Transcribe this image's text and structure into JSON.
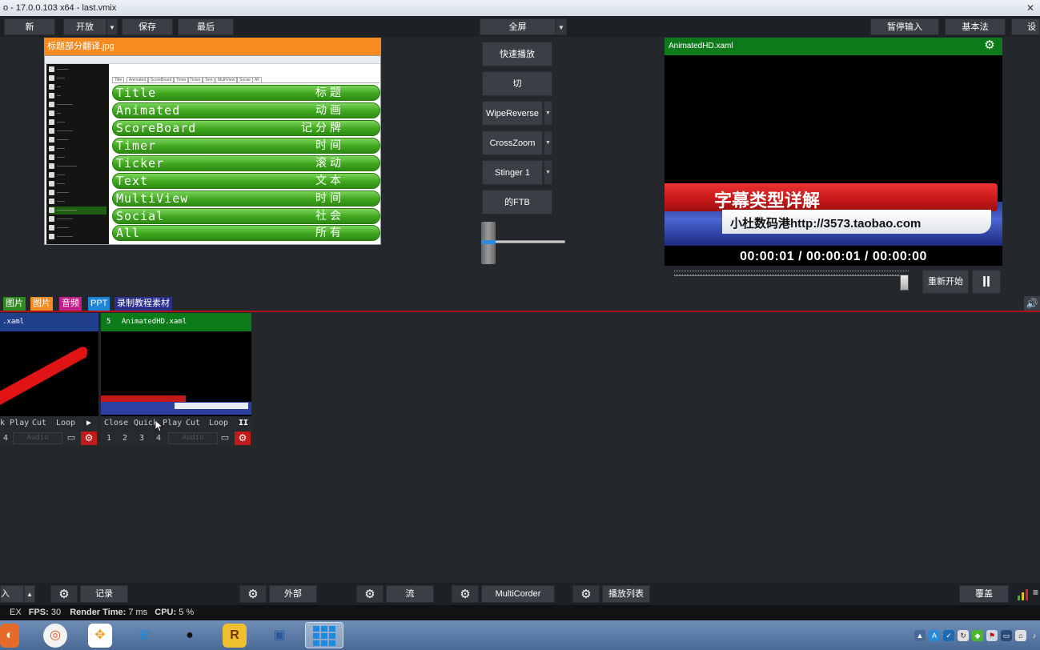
{
  "window": {
    "title": "o - 17.0.0.103 x64 - last.vmix"
  },
  "toolbar": {
    "new": "新",
    "open": "开放",
    "save": "保存",
    "last": "最后",
    "fullscreen": "全屏",
    "pause_input": "暂停输入",
    "basic": "基本法",
    "settings_cut": "设"
  },
  "preview": {
    "title": "标题部分翻译.jpg",
    "tabs": [
      "Title",
      "Animated",
      "ScoreBoard",
      "Timer",
      "Ticker",
      "Text",
      "MultiView",
      "Social",
      "All"
    ],
    "rows": [
      {
        "en": "Title",
        "zh": "标题"
      },
      {
        "en": "Animated",
        "zh": "动画"
      },
      {
        "en": "ScoreBoard",
        "zh": "记分牌"
      },
      {
        "en": "Timer",
        "zh": "时间"
      },
      {
        "en": "Ticker",
        "zh": "滚动"
      },
      {
        "en": "Text",
        "zh": "文本"
      },
      {
        "en": "MultiView",
        "zh": "时间"
      },
      {
        "en": "Social",
        "zh": "社会"
      },
      {
        "en": "All",
        "zh": "所有"
      }
    ]
  },
  "transitions": {
    "quick_play": "快速播放",
    "cut": "切",
    "t1": "WipeReverse",
    "t2": "CrossZoom",
    "t3": "Stinger 1",
    "ftb": "的FTB"
  },
  "output": {
    "title": "AnimatedHD.xaml",
    "caption_title": "字幕类型详解",
    "caption_sub": "小杜数码港http://3573.taobao.com",
    "timecode": "00:00:01  /  00:00:01  /  00:00:00",
    "restart": "重新开始",
    "pause": "II",
    "seek_fraction": 0.98
  },
  "categories": [
    {
      "label": "图片",
      "color": "#2f8a1f"
    },
    {
      "label": "图片",
      "color": "#f68a1e"
    },
    {
      "label": "音频",
      "color": "#c0208a"
    },
    {
      "label": "PPT",
      "color": "#1e86d8"
    },
    {
      "label": "录制教程素材",
      "color": "#2a2f8c"
    }
  ],
  "inputs": [
    {
      "number": "",
      "title": ".xaml",
      "ctl": {
        "play": "k Play",
        "cut": "Cut",
        "loop": "Loop",
        "state": "▶"
      },
      "nums": [
        "4"
      ],
      "audio": "Audio"
    },
    {
      "number": "5",
      "title": "AnimatedHD.xaml",
      "ctl": {
        "close": "Close",
        "play": "Quick Play",
        "cut": "Cut",
        "loop": "Loop",
        "state": "II"
      },
      "nums": [
        "1",
        "2",
        "3",
        "4"
      ],
      "audio": "Audio"
    }
  ],
  "bottom": {
    "add_input": "入",
    "record": "记录",
    "external": "外部",
    "stream": "流",
    "multicorder": "MultiCorder",
    "playlist": "播放列表",
    "overlay": "覆盖"
  },
  "status": {
    "ex": "EX",
    "fps_label": "FPS:",
    "fps": "30",
    "render_label": "Render Time:",
    "render": "7 ms",
    "cpu_label": "CPU:",
    "cpu": "5 %"
  },
  "taskbar": {
    "icons": [
      "app-icon",
      "360-icon",
      "pinwheel-icon",
      "windows-media-icon",
      "qq-icon",
      "r-icon",
      "network-icon",
      "vmix-icon"
    ]
  },
  "colors": {
    "preview_header": "#f68a1e",
    "output_header": "#0d7a1a",
    "divider": "#b0121b",
    "gear_red": "#c01a1a"
  }
}
